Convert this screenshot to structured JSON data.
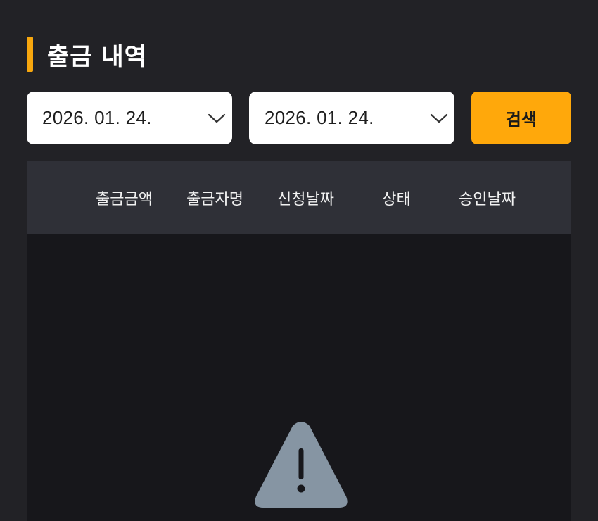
{
  "header": {
    "title": "출금 내역"
  },
  "filter": {
    "start_date": "2026. 01. 24.",
    "end_date": "2026. 01. 24.",
    "search_label": "검색"
  },
  "table": {
    "columns": [
      "출금금액",
      "출금자명",
      "신청날짜",
      "상태",
      "승인날짜"
    ],
    "rows": []
  },
  "colors": {
    "accent": "#FFA80B",
    "background": "#222226",
    "table_header_bg": "#2F3037",
    "table_body_bg": "#17171B",
    "empty_icon": "#8695A3"
  },
  "icons": {
    "dropdown": "chevron-down-icon",
    "empty_state": "warning-triangle-icon"
  }
}
